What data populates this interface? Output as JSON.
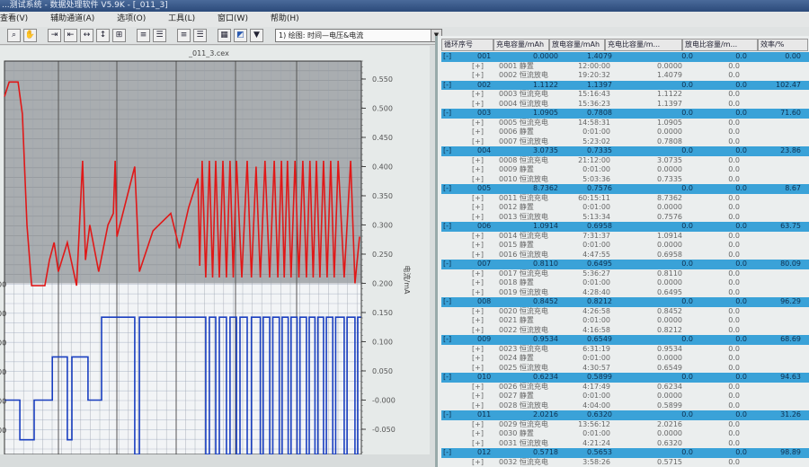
{
  "window": {
    "title": "...测试系统 - 数据处理软件 V5.9K - [_011_3]"
  },
  "menu": [
    "查看(V)",
    "辅助通道(A)",
    "选项(O)",
    "工具(L)",
    "窗口(W)",
    "帮助(H)"
  ],
  "toolbar": {
    "buttons": [
      "zoom",
      "pan",
      "h-compress",
      "h-expand",
      "fit-h",
      "fit-v",
      "fit-all",
      "list1",
      "list2",
      "list3",
      "list4",
      "layout",
      "export",
      "color",
      "pin"
    ],
    "plot_select": "1) 绘图: 时间—电压&电流"
  },
  "chart_panel": {
    "filename": "_011_3.cex"
  },
  "chart_data": {
    "type": "line",
    "title": "_011_3.cex",
    "ylabel_right": "电流/mA",
    "right_ticks": [
      "0.550",
      "0.500",
      "0.450",
      "0.400",
      "0.350",
      "0.300",
      "0.250",
      "0.200",
      "0.150",
      "0.100",
      "0.050",
      "-0.000",
      "-0.050",
      "-0.100"
    ],
    "left_ticks": [
      "00",
      "00",
      "00",
      "00",
      "00",
      "00",
      "00"
    ],
    "ylim_right": [
      -0.1,
      0.55
    ],
    "xlim": [
      0,
      100
    ],
    "grid": true,
    "series": [
      {
        "name": "电压",
        "color": "#e01818",
        "points": [
          [
            0,
            0.52
          ],
          [
            1.3,
            0.545
          ],
          [
            3.8,
            0.545
          ],
          [
            5,
            0.49
          ],
          [
            6.3,
            0.3
          ],
          [
            7.6,
            0.196
          ],
          [
            11.3,
            0.196
          ],
          [
            12.6,
            0.24
          ],
          [
            13.9,
            0.27
          ],
          [
            15.1,
            0.22
          ],
          [
            17.6,
            0.27
          ],
          [
            20.2,
            0.196
          ],
          [
            21.9,
            0.41
          ],
          [
            22.7,
            0.24
          ],
          [
            23.9,
            0.3
          ],
          [
            26.4,
            0.22
          ],
          [
            29,
            0.3
          ],
          [
            30.5,
            0.32
          ],
          [
            31,
            0.41
          ],
          [
            31.5,
            0.28
          ],
          [
            36.5,
            0.4
          ],
          [
            37.8,
            0.22
          ],
          [
            41.6,
            0.29
          ],
          [
            46.6,
            0.32
          ],
          [
            49,
            0.26
          ],
          [
            51.6,
            0.33
          ],
          [
            54.2,
            0.38
          ],
          [
            54.7,
            0.23
          ],
          [
            55.4,
            0.41
          ],
          [
            56.4,
            0.21
          ],
          [
            57.4,
            0.41
          ],
          [
            58.3,
            0.21
          ],
          [
            59.2,
            0.41
          ],
          [
            60.2,
            0.21
          ],
          [
            61.2,
            0.41
          ],
          [
            62.2,
            0.21
          ],
          [
            63.2,
            0.41
          ],
          [
            64.1,
            0.21
          ],
          [
            65,
            0.41
          ],
          [
            66.5,
            0.21
          ],
          [
            68,
            0.41
          ],
          [
            69.2,
            0.21
          ],
          [
            70.5,
            0.4
          ],
          [
            71.7,
            0.21
          ],
          [
            73,
            0.41
          ],
          [
            74.3,
            0.21
          ],
          [
            75.6,
            0.41
          ],
          [
            76.6,
            0.21
          ],
          [
            77.6,
            0.41
          ],
          [
            78.4,
            0.21
          ],
          [
            79.3,
            0.41
          ],
          [
            80.3,
            0.21
          ],
          [
            81.4,
            0.41
          ],
          [
            82.5,
            0.21
          ],
          [
            83.6,
            0.41
          ],
          [
            84.6,
            0.21
          ],
          [
            85.6,
            0.41
          ],
          [
            86.5,
            0.21
          ],
          [
            87.4,
            0.41
          ],
          [
            88.4,
            0.21
          ],
          [
            89.4,
            0.41
          ],
          [
            90.4,
            0.21
          ],
          [
            91.4,
            0.41
          ],
          [
            92.4,
            0.21
          ],
          [
            93.5,
            0.41
          ],
          [
            95.2,
            0.21
          ],
          [
            97,
            0.41
          ],
          [
            98.2,
            0.2
          ],
          [
            99.5,
            0.28
          ]
        ]
      },
      {
        "name": "电流",
        "color": "#1a3fc0",
        "points": [
          [
            0,
            0
          ],
          [
            4.3,
            0
          ],
          [
            4.3,
            -0.068
          ],
          [
            8.3,
            -0.068
          ],
          [
            8.3,
            0
          ],
          [
            13.4,
            0
          ],
          [
            13.4,
            0.074
          ],
          [
            17.6,
            0.074
          ],
          [
            17.6,
            -0.068
          ],
          [
            18.9,
            -0.068
          ],
          [
            18.9,
            0.074
          ],
          [
            23.4,
            0.074
          ],
          [
            23.4,
            0
          ],
          [
            27.2,
            0
          ],
          [
            27.2,
            0.142
          ],
          [
            36.5,
            0.142
          ],
          [
            36.5,
            -0.093
          ],
          [
            37.8,
            -0.093
          ],
          [
            37.8,
            0.142
          ],
          [
            56.4,
            0.142
          ],
          [
            56.4,
            -0.093
          ],
          [
            57.4,
            -0.093
          ],
          [
            57.4,
            0.142
          ],
          [
            59.2,
            0.142
          ],
          [
            59.2,
            -0.093
          ],
          [
            60.2,
            -0.093
          ],
          [
            60.2,
            0.142
          ],
          [
            62.2,
            0.142
          ],
          [
            62.2,
            -0.093
          ],
          [
            63.2,
            -0.093
          ],
          [
            63.2,
            0.142
          ],
          [
            65,
            0.142
          ],
          [
            65,
            -0.093
          ],
          [
            66,
            -0.093
          ],
          [
            66,
            0.142
          ],
          [
            68,
            0.142
          ],
          [
            68,
            -0.093
          ],
          [
            69.2,
            -0.093
          ],
          [
            69.2,
            0.142
          ],
          [
            71.7,
            0.142
          ],
          [
            71.7,
            -0.093
          ],
          [
            72.5,
            -0.093
          ],
          [
            72.5,
            0.142
          ],
          [
            74.3,
            0.142
          ],
          [
            74.3,
            -0.093
          ],
          [
            75.2,
            -0.093
          ],
          [
            75.2,
            0.142
          ],
          [
            77,
            0.142
          ],
          [
            77,
            -0.093
          ],
          [
            77.8,
            -0.093
          ],
          [
            77.8,
            0.142
          ],
          [
            79.5,
            0.142
          ],
          [
            79.5,
            -0.093
          ],
          [
            80.3,
            -0.093
          ],
          [
            80.3,
            0.142
          ],
          [
            82,
            0.142
          ],
          [
            82,
            -0.093
          ],
          [
            82.8,
            -0.093
          ],
          [
            82.8,
            0.142
          ],
          [
            84.6,
            0.142
          ],
          [
            84.6,
            -0.093
          ],
          [
            85.4,
            -0.093
          ],
          [
            85.4,
            0.142
          ],
          [
            87,
            0.142
          ],
          [
            87,
            -0.093
          ],
          [
            87.8,
            -0.093
          ],
          [
            87.8,
            0.142
          ],
          [
            89.4,
            0.142
          ],
          [
            89.4,
            -0.093
          ],
          [
            90.2,
            -0.093
          ],
          [
            90.2,
            0.142
          ],
          [
            92,
            0.142
          ],
          [
            92,
            -0.093
          ],
          [
            92.8,
            -0.093
          ],
          [
            92.8,
            0.142
          ],
          [
            95.2,
            0.142
          ],
          [
            95.2,
            -0.093
          ],
          [
            96,
            -0.093
          ],
          [
            96,
            0.142
          ],
          [
            98.2,
            0.142
          ],
          [
            98.2,
            -0.093
          ],
          [
            99,
            -0.093
          ],
          [
            99,
            0.142
          ],
          [
            100,
            0.142
          ]
        ]
      }
    ]
  },
  "table": {
    "headers": [
      "循环序号",
      "充电容量/mAh",
      "放电容量/mAh",
      "充电比容量/m...",
      "放电比容量/m...",
      "效率/%"
    ],
    "cycles": [
      {
        "toggle": "[-]",
        "id": "001",
        "charge": "0.0000",
        "discharge": "1.4079",
        "cspec": "0.0",
        "dspec": "0.0",
        "eff": "0.00",
        "steps": [
          {
            "toggle": "[+]",
            "name": "0001 静置",
            "time": "12:00:00",
            "cap": "0.0000",
            "spec": "0.0"
          },
          {
            "toggle": "[+]",
            "name": "0002 恒流放电",
            "time": "19:20:32",
            "cap": "1.4079",
            "spec": "0.0"
          }
        ]
      },
      {
        "toggle": "[-]",
        "id": "002",
        "charge": "1.1122",
        "discharge": "1.1397",
        "cspec": "0.0",
        "dspec": "0.0",
        "eff": "102.47",
        "steps": [
          {
            "toggle": "[+]",
            "name": "0003 恒流充电",
            "time": "15:16:43",
            "cap": "1.1122",
            "spec": "0.0"
          },
          {
            "toggle": "[+]",
            "name": "0004 恒流放电",
            "time": "15:36:23",
            "cap": "1.1397",
            "spec": "0.0"
          }
        ]
      },
      {
        "toggle": "[-]",
        "id": "003",
        "charge": "1.0905",
        "discharge": "0.7808",
        "cspec": "0.0",
        "dspec": "0.0",
        "eff": "71.60",
        "steps": [
          {
            "toggle": "[+]",
            "name": "0005 恒流充电",
            "time": "14:58:31",
            "cap": "1.0905",
            "spec": "0.0"
          },
          {
            "toggle": "[+]",
            "name": "0006 静置",
            "time": "0:01:00",
            "cap": "0.0000",
            "spec": "0.0"
          },
          {
            "toggle": "[+]",
            "name": "0007 恒流放电",
            "time": "5:23:02",
            "cap": "0.7808",
            "spec": "0.0"
          }
        ]
      },
      {
        "toggle": "[-]",
        "id": "004",
        "charge": "3.0735",
        "discharge": "0.7335",
        "cspec": "0.0",
        "dspec": "0.0",
        "eff": "23.86",
        "steps": [
          {
            "toggle": "[+]",
            "name": "0008 恒流充电",
            "time": "21:12:00",
            "cap": "3.0735",
            "spec": "0.0"
          },
          {
            "toggle": "[+]",
            "name": "0009 静置",
            "time": "0:01:00",
            "cap": "0.0000",
            "spec": "0.0"
          },
          {
            "toggle": "[+]",
            "name": "0010 恒流放电",
            "time": "5:03:36",
            "cap": "0.7335",
            "spec": "0.0"
          }
        ]
      },
      {
        "toggle": "[-]",
        "id": "005",
        "charge": "8.7362",
        "discharge": "0.7576",
        "cspec": "0.0",
        "dspec": "0.0",
        "eff": "8.67",
        "steps": [
          {
            "toggle": "[+]",
            "name": "0011 恒流充电",
            "time": "60:15:11",
            "cap": "8.7362",
            "spec": "0.0"
          },
          {
            "toggle": "[+]",
            "name": "0012 静置",
            "time": "0:01:00",
            "cap": "0.0000",
            "spec": "0.0"
          },
          {
            "toggle": "[+]",
            "name": "0013 恒流放电",
            "time": "5:13:34",
            "cap": "0.7576",
            "spec": "0.0"
          }
        ]
      },
      {
        "toggle": "[-]",
        "id": "006",
        "charge": "1.0914",
        "discharge": "0.6958",
        "cspec": "0.0",
        "dspec": "0.0",
        "eff": "63.75",
        "steps": [
          {
            "toggle": "[+]",
            "name": "0014 恒流充电",
            "time": "7:31:37",
            "cap": "1.0914",
            "spec": "0.0"
          },
          {
            "toggle": "[+]",
            "name": "0015 静置",
            "time": "0:01:00",
            "cap": "0.0000",
            "spec": "0.0"
          },
          {
            "toggle": "[+]",
            "name": "0016 恒流放电",
            "time": "4:47:55",
            "cap": "0.6958",
            "spec": "0.0"
          }
        ]
      },
      {
        "toggle": "[-]",
        "id": "007",
        "charge": "0.8110",
        "discharge": "0.6495",
        "cspec": "0.0",
        "dspec": "0.0",
        "eff": "80.09",
        "steps": [
          {
            "toggle": "[+]",
            "name": "0017 恒流充电",
            "time": "5:36:27",
            "cap": "0.8110",
            "spec": "0.0"
          },
          {
            "toggle": "[+]",
            "name": "0018 静置",
            "time": "0:01:00",
            "cap": "0.0000",
            "spec": "0.0"
          },
          {
            "toggle": "[+]",
            "name": "0019 恒流放电",
            "time": "4:28:40",
            "cap": "0.6495",
            "spec": "0.0"
          }
        ]
      },
      {
        "toggle": "[-]",
        "id": "008",
        "charge": "0.8452",
        "discharge": "0.8212",
        "cspec": "0.0",
        "dspec": "0.0",
        "eff": "96.29",
        "steps": [
          {
            "toggle": "[+]",
            "name": "0020 恒流充电",
            "time": "4:26:58",
            "cap": "0.8452",
            "spec": "0.0"
          },
          {
            "toggle": "[+]",
            "name": "0021 静置",
            "time": "0:01:00",
            "cap": "0.0000",
            "spec": "0.0"
          },
          {
            "toggle": "[+]",
            "name": "0022 恒流放电",
            "time": "4:16:58",
            "cap": "0.8212",
            "spec": "0.0"
          }
        ]
      },
      {
        "toggle": "[-]",
        "id": "009",
        "charge": "0.9534",
        "discharge": "0.6549",
        "cspec": "0.0",
        "dspec": "0.0",
        "eff": "68.69",
        "steps": [
          {
            "toggle": "[+]",
            "name": "0023 恒流充电",
            "time": "6:31:19",
            "cap": "0.9534",
            "spec": "0.0"
          },
          {
            "toggle": "[+]",
            "name": "0024 静置",
            "time": "0:01:00",
            "cap": "0.0000",
            "spec": "0.0"
          },
          {
            "toggle": "[+]",
            "name": "0025 恒流放电",
            "time": "4:30:57",
            "cap": "0.6549",
            "spec": "0.0"
          }
        ]
      },
      {
        "toggle": "[-]",
        "id": "010",
        "charge": "0.6234",
        "discharge": "0.5899",
        "cspec": "0.0",
        "dspec": "0.0",
        "eff": "94.63",
        "steps": [
          {
            "toggle": "[+]",
            "name": "0026 恒流充电",
            "time": "4:17:49",
            "cap": "0.6234",
            "spec": "0.0"
          },
          {
            "toggle": "[+]",
            "name": "0027 静置",
            "time": "0:01:00",
            "cap": "0.0000",
            "spec": "0.0"
          },
          {
            "toggle": "[+]",
            "name": "0028 恒流放电",
            "time": "4:04:00",
            "cap": "0.5899",
            "spec": "0.0"
          }
        ]
      },
      {
        "toggle": "[-]",
        "id": "011",
        "charge": "2.0216",
        "discharge": "0.6320",
        "cspec": "0.0",
        "dspec": "0.0",
        "eff": "31.26",
        "steps": [
          {
            "toggle": "[+]",
            "name": "0029 恒流充电",
            "time": "13:56:12",
            "cap": "2.0216",
            "spec": "0.0"
          },
          {
            "toggle": "[+]",
            "name": "0030 静置",
            "time": "0:01:00",
            "cap": "0.0000",
            "spec": "0.0"
          },
          {
            "toggle": "[+]",
            "name": "0031 恒流放电",
            "time": "4:21:24",
            "cap": "0.6320",
            "spec": "0.0"
          }
        ]
      },
      {
        "toggle": "[-]",
        "id": "012",
        "charge": "0.5718",
        "discharge": "0.5653",
        "cspec": "0.0",
        "dspec": "0.0",
        "eff": "98.89",
        "steps": [
          {
            "toggle": "[+]",
            "name": "0032 恒流充电",
            "time": "3:58:26",
            "cap": "0.5715",
            "spec": "0.0"
          }
        ]
      }
    ]
  }
}
